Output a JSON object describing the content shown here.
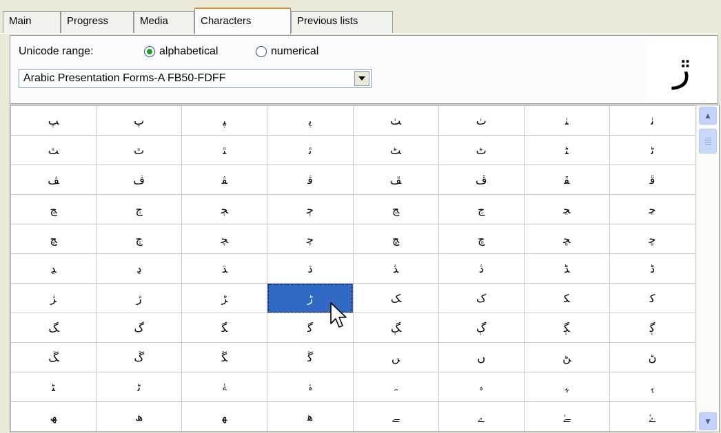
{
  "tabs": [
    {
      "label": "Main"
    },
    {
      "label": "Progress"
    },
    {
      "label": "Media"
    },
    {
      "label": "Characters"
    },
    {
      "label": "Previous lists"
    }
  ],
  "active_tab": "Characters",
  "range": {
    "label": "Unicode range:",
    "options": [
      {
        "label": "alphabetical",
        "checked": true
      },
      {
        "label": "numerical",
        "checked": false
      }
    ],
    "selected": "Arabic Presentation Forms-A FB50-FDFF"
  },
  "preview_char": "ڙ",
  "grid": {
    "selected": {
      "row": 6,
      "col": 3
    },
    "rows": [
      [
        "ﭗ",
        "ﭖ",
        "ﭙ",
        "ﭘ",
        "ﭟ",
        "ﭞ",
        "ﭡ",
        "ﭠ"
      ],
      [
        "ﭣ",
        "ﭢ",
        "ﭥ",
        "ﭤ",
        "ﭧ",
        "ﭦ",
        "ﭩ",
        "ﭨ"
      ],
      [
        "ﭫ",
        "ﭪ",
        "ﭭ",
        "ﭬ",
        "ﭯ",
        "ﭮ",
        "ﭱ",
        "ﭰ"
      ],
      [
        "ﭳ",
        "ﭲ",
        "ﭵ",
        "ﭴ",
        "ﭷ",
        "ﭶ",
        "ﭹ",
        "ﭸ"
      ],
      [
        "ﭻ",
        "ﭺ",
        "ﭽ",
        "ﭼ",
        "ﭿ",
        "ﭾ",
        "ﮁ",
        "ﮀ"
      ],
      [
        "ﮃ",
        "ﮂ",
        "ﮅ",
        "ﮄ",
        "ﮇ",
        "ﮆ",
        "ﮉ",
        "ﮈ"
      ],
      [
        "ﮋ",
        "ﮊ",
        "ﮍ",
        "ﮌ",
        "ﮏ",
        "ﮎ",
        "ﮑ",
        "ﮐ"
      ],
      [
        "ﮓ",
        "ﮒ",
        "ﮕ",
        "ﮔ",
        "ﮗ",
        "ﮖ",
        "ﮙ",
        "ﮘ"
      ],
      [
        "ﮛ",
        "ﮚ",
        "ﮝ",
        "ﮜ",
        "ﮟ",
        "ﮞ",
        "ﮡ",
        "ﮠ"
      ],
      [
        "ﮣ",
        "ﮢ",
        "ﮥ",
        "ﮤ",
        "ﮧ",
        "ﮦ",
        "ﮩ",
        "ﮨ"
      ],
      [
        "ﮫ",
        "ﮪ",
        "ﮭ",
        "ﮬ",
        "ﮯ",
        "ﮮ",
        "ﮱ",
        "ﮰ"
      ]
    ]
  },
  "icons": {
    "scroll_up": "chevron-up-icon",
    "scroll_down": "chevron-down-icon",
    "dropdown": "dropdown-arrow-icon",
    "cursor": "mouse-pointer-icon"
  },
  "colors": {
    "selection": "#316ac5",
    "active_tab_accent": "#e68b2c",
    "radio_dot": "#21a121",
    "window_bg": "#ece9d8"
  }
}
